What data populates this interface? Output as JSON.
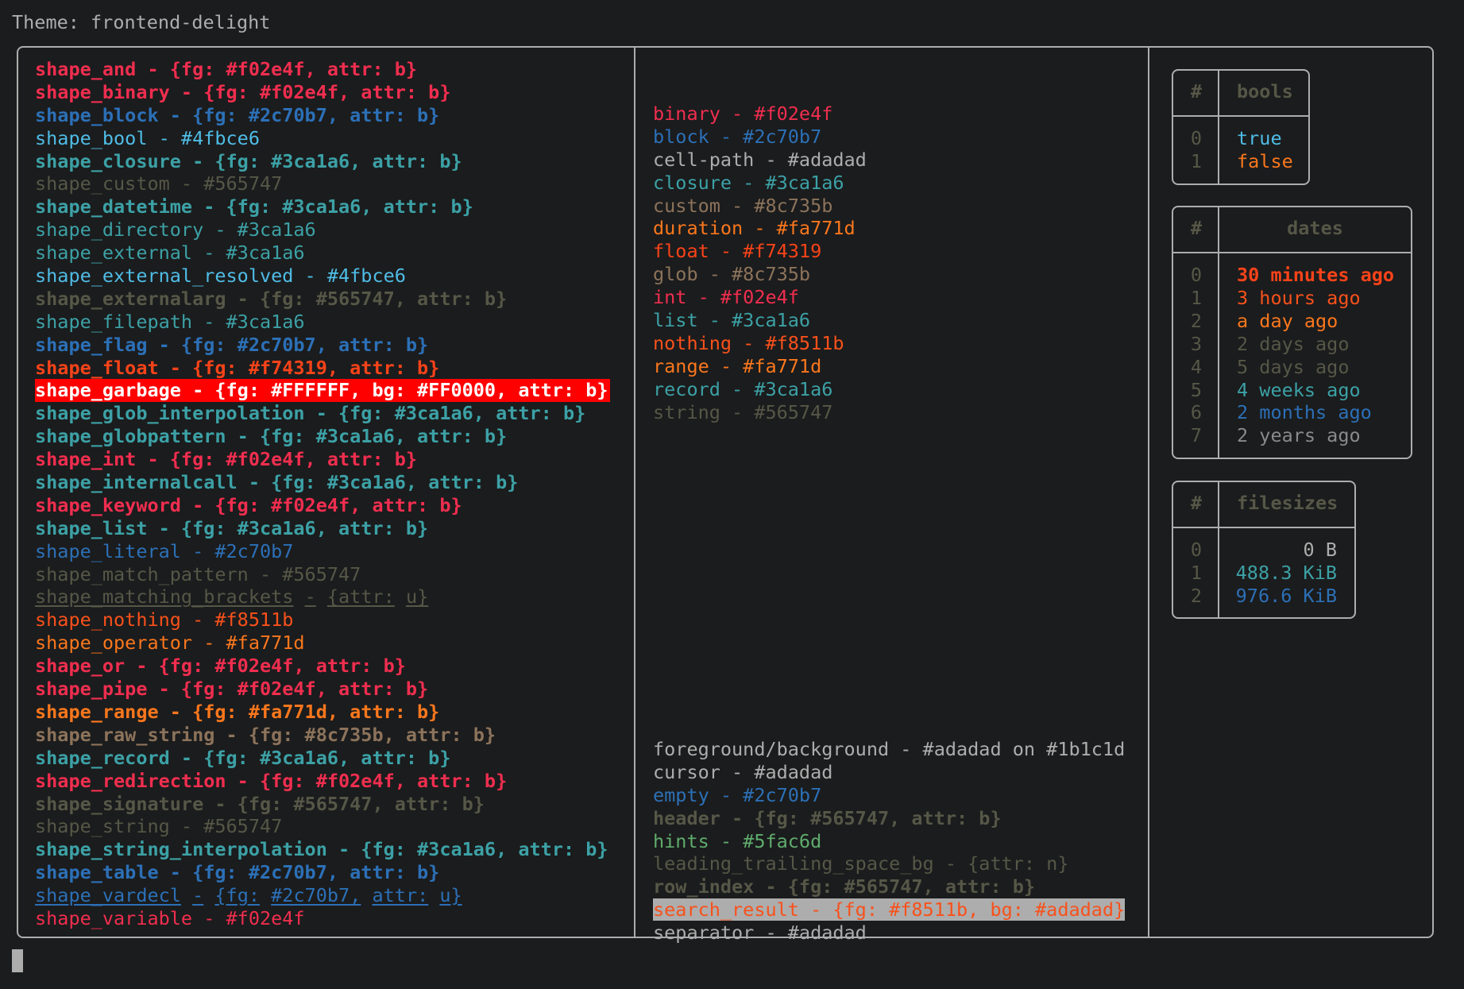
{
  "theme_label": "Theme: frontend-delight",
  "colors": {
    "background": "#1b1c1d",
    "foreground": "#adadad",
    "border": "#adadad",
    "header": "#565747"
  },
  "left_column": [
    {
      "text": "shape_and - {fg: #f02e4f, attr: b}",
      "fg": "#f02e4f",
      "bold": true
    },
    {
      "text": "shape_binary - {fg: #f02e4f, attr: b}",
      "fg": "#f02e4f",
      "bold": true
    },
    {
      "text": "shape_block - {fg: #2c70b7, attr: b}",
      "fg": "#2c70b7",
      "bold": true
    },
    {
      "text": "shape_bool - #4fbce6",
      "fg": "#4fbce6"
    },
    {
      "text": "shape_closure - {fg: #3ca1a6, attr: b}",
      "fg": "#3ca1a6",
      "bold": true
    },
    {
      "text": "shape_custom - #565747",
      "fg": "#565747"
    },
    {
      "text": "shape_datetime - {fg: #3ca1a6, attr: b}",
      "fg": "#3ca1a6",
      "bold": true
    },
    {
      "text": "shape_directory - #3ca1a6",
      "fg": "#3ca1a6"
    },
    {
      "text": "shape_external - #3ca1a6",
      "fg": "#3ca1a6"
    },
    {
      "text": "shape_external_resolved - #4fbce6",
      "fg": "#4fbce6"
    },
    {
      "text": "shape_externalarg - {fg: #565747, attr: b}",
      "fg": "#565747",
      "bold": true
    },
    {
      "text": "shape_filepath - #3ca1a6",
      "fg": "#3ca1a6"
    },
    {
      "text": "shape_flag - {fg: #2c70b7, attr: b}",
      "fg": "#2c70b7",
      "bold": true
    },
    {
      "text": "shape_float - {fg: #f74319, attr: b}",
      "fg": "#f74319",
      "bold": true
    },
    {
      "text": "shape_garbage - {fg: #FFFFFF, bg: #FF0000, attr: b}",
      "fg": "#FFFFFF",
      "bg": "#FF0000",
      "bold": true
    },
    {
      "text": "shape_glob_interpolation - {fg: #3ca1a6, attr: b}",
      "fg": "#3ca1a6",
      "bold": true
    },
    {
      "text": "shape_globpattern - {fg: #3ca1a6, attr: b}",
      "fg": "#3ca1a6",
      "bold": true
    },
    {
      "text": "shape_int - {fg: #f02e4f, attr: b}",
      "fg": "#f02e4f",
      "bold": true
    },
    {
      "text": "shape_internalcall - {fg: #3ca1a6, attr: b}",
      "fg": "#3ca1a6",
      "bold": true
    },
    {
      "text": "shape_keyword - {fg: #f02e4f, attr: b}",
      "fg": "#f02e4f",
      "bold": true
    },
    {
      "text": "shape_list - {fg: #3ca1a6, attr: b}",
      "fg": "#3ca1a6",
      "bold": true
    },
    {
      "text": "shape_literal - #2c70b7",
      "fg": "#2c70b7"
    },
    {
      "text": "shape_match_pattern - #565747",
      "fg": "#565747"
    },
    {
      "text": "shape_matching_brackets - {attr: u}",
      "fg": "#565747",
      "underline": true
    },
    {
      "text": "shape_nothing - #f8511b",
      "fg": "#f8511b"
    },
    {
      "text": "shape_operator - #fa771d",
      "fg": "#fa771d"
    },
    {
      "text": "shape_or - {fg: #f02e4f, attr: b}",
      "fg": "#f02e4f",
      "bold": true
    },
    {
      "text": "shape_pipe - {fg: #f02e4f, attr: b}",
      "fg": "#f02e4f",
      "bold": true
    },
    {
      "text": "shape_range - {fg: #fa771d, attr: b}",
      "fg": "#fa771d",
      "bold": true
    },
    {
      "text": "shape_raw_string - {fg: #8c735b, attr: b}",
      "fg": "#8c735b",
      "bold": true
    },
    {
      "text": "shape_record - {fg: #3ca1a6, attr: b}",
      "fg": "#3ca1a6",
      "bold": true
    },
    {
      "text": "shape_redirection - {fg: #f02e4f, attr: b}",
      "fg": "#f02e4f",
      "bold": true
    },
    {
      "text": "shape_signature - {fg: #565747, attr: b}",
      "fg": "#565747",
      "bold": true
    },
    {
      "text": "shape_string - #565747",
      "fg": "#565747"
    },
    {
      "text": "shape_string_interpolation - {fg: #3ca1a6, attr: b}",
      "fg": "#3ca1a6",
      "bold": true
    },
    {
      "text": "shape_table - {fg: #2c70b7, attr: b}",
      "fg": "#2c70b7",
      "bold": true
    },
    {
      "text": "shape_vardecl - {fg: #2c70b7, attr: u}",
      "fg": "#2c70b7",
      "underline": true
    },
    {
      "text": "shape_variable - #f02e4f",
      "fg": "#f02e4f"
    }
  ],
  "middle_column_types": [
    {
      "text": "binary - #f02e4f",
      "fg": "#f02e4f"
    },
    {
      "text": "block - #2c70b7",
      "fg": "#2c70b7"
    },
    {
      "text": "cell-path - #adadad",
      "fg": "#adadad"
    },
    {
      "text": "closure - #3ca1a6",
      "fg": "#3ca1a6"
    },
    {
      "text": "custom - #8c735b",
      "fg": "#8c735b"
    },
    {
      "text": "duration - #fa771d",
      "fg": "#fa771d"
    },
    {
      "text": "float - #f74319",
      "fg": "#f74319"
    },
    {
      "text": "glob - #8c735b",
      "fg": "#8c735b"
    },
    {
      "text": "int - #f02e4f",
      "fg": "#f02e4f"
    },
    {
      "text": "list - #3ca1a6",
      "fg": "#3ca1a6"
    },
    {
      "text": "nothing - #f8511b",
      "fg": "#f8511b"
    },
    {
      "text": "range - #fa771d",
      "fg": "#fa771d"
    },
    {
      "text": "record - #3ca1a6",
      "fg": "#3ca1a6"
    },
    {
      "text": "string - #565747",
      "fg": "#565747"
    }
  ],
  "middle_column_ui": [
    {
      "text": "foreground/background - #adadad on #1b1c1d",
      "fg": "#adadad"
    },
    {
      "text": "cursor - #adadad",
      "fg": "#adadad"
    },
    {
      "text": "empty - #2c70b7",
      "fg": "#2c70b7"
    },
    {
      "text": "header - {fg: #565747, attr: b}",
      "fg": "#565747",
      "bold": true
    },
    {
      "text": "hints - #5fac6d",
      "fg": "#5fac6d"
    },
    {
      "text": "leading_trailing_space_bg - {attr: n}",
      "fg": "#565747"
    },
    {
      "text": "row_index - {fg: #565747, attr: b}",
      "fg": "#565747",
      "bold": true
    },
    {
      "text": "search_result - {fg: #f8511b, bg: #adadad}",
      "fg": "#f8511b",
      "bg": "#adadad"
    },
    {
      "text": "separator - #adadad",
      "fg": "#adadad"
    }
  ],
  "tables": {
    "bools": {
      "index_header": "#",
      "header": "bools",
      "rows": [
        {
          "index": "0",
          "value": "true",
          "fg": "#4fbce6"
        },
        {
          "index": "1",
          "value": "false",
          "fg": "#fa771d"
        }
      ]
    },
    "dates": {
      "index_header": "#",
      "header": "dates",
      "rows": [
        {
          "index": "0",
          "value": "30 minutes ago",
          "fg": "#f74319",
          "bold": true
        },
        {
          "index": "1",
          "value": "3 hours ago",
          "fg": "#f8511b"
        },
        {
          "index": "2",
          "value": "a day ago",
          "fg": "#fa771d"
        },
        {
          "index": "3",
          "value": "2 days ago",
          "fg": "#565747"
        },
        {
          "index": "4",
          "value": "5 days ago",
          "fg": "#565747"
        },
        {
          "index": "5",
          "value": "4 weeks ago",
          "fg": "#3ca1a6"
        },
        {
          "index": "6",
          "value": "2 months ago",
          "fg": "#2c70b7"
        },
        {
          "index": "7",
          "value": "2 years ago",
          "fg": "#8a8a8a"
        }
      ]
    },
    "filesizes": {
      "index_header": "#",
      "header": "filesizes",
      "rows": [
        {
          "index": "0",
          "value": "0 B",
          "fg": "#adadad"
        },
        {
          "index": "1",
          "value": "488.3 KiB",
          "fg": "#3ca1a6"
        },
        {
          "index": "2",
          "value": "976.6 KiB",
          "fg": "#2c70b7"
        }
      ]
    }
  }
}
